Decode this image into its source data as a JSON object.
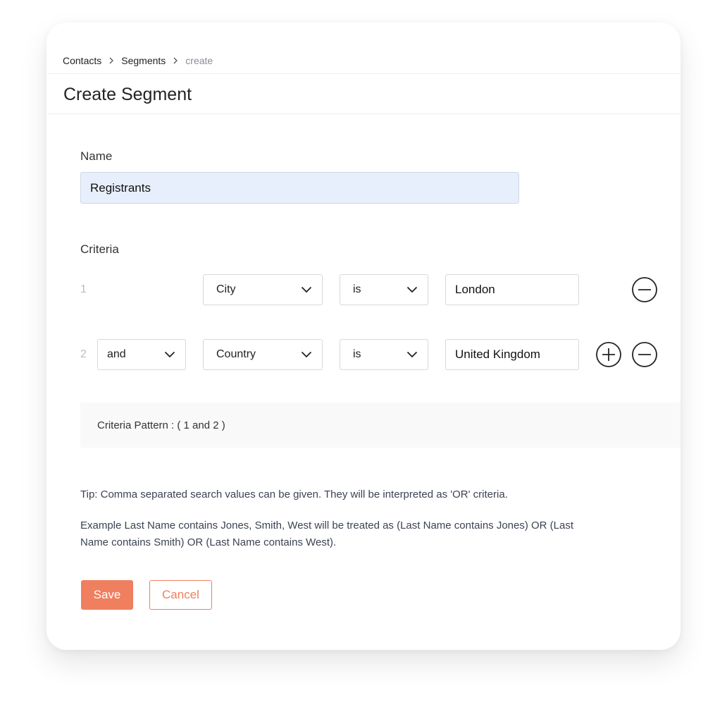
{
  "breadcrumb": {
    "items": [
      "Contacts",
      "Segments",
      "create"
    ]
  },
  "header": {
    "title": "Create Segment"
  },
  "form": {
    "name_label": "Name",
    "name_value": "Registrants",
    "criteria_label": "Criteria",
    "criteria": [
      {
        "number": "1",
        "logic": null,
        "field": "City",
        "operator": "is",
        "value": "London",
        "actions": [
          "remove"
        ]
      },
      {
        "number": "2",
        "logic": "and",
        "field": "Country",
        "operator": "is",
        "value": "United Kingdom",
        "actions": [
          "add",
          "remove"
        ]
      }
    ],
    "pattern_text": "Criteria Pattern : ( 1 and 2 )",
    "tip": "Tip: Comma separated search values can be given. They will be interpreted as 'OR' criteria.",
    "example": "Example  Last Name contains Jones, Smith, West will be treated as (Last Name contains Jones) OR (Last Name contains Smith) OR (Last Name contains West)."
  },
  "actions": {
    "save_label": "Save",
    "cancel_label": "Cancel"
  },
  "icons": {
    "breadcrumb_separator": "chevron-right-icon",
    "dropdown": "chevron-down-icon",
    "add_criteria": "plus-circle-icon",
    "remove_criteria": "minus-circle-icon"
  },
  "colors": {
    "accent": "#ef7f5f",
    "name_input_bg": "#e8effc",
    "pattern_bg": "#f9f9f9",
    "breadcrumb_current": "#888d96"
  }
}
